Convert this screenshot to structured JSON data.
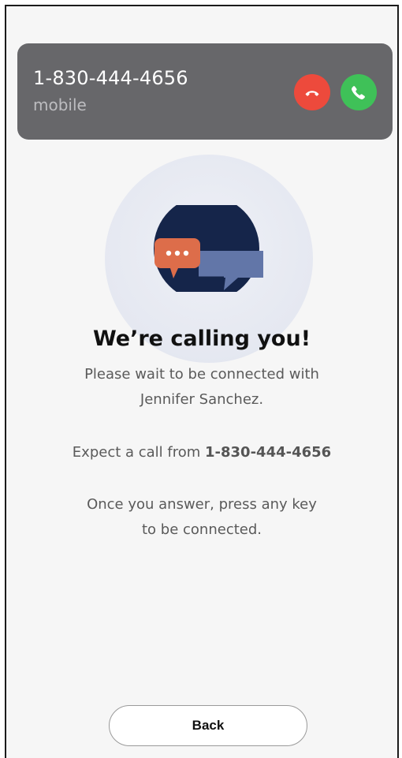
{
  "notification": {
    "caller_number": "1-830-444-4656",
    "caller_type": "mobile",
    "decline_icon": "phone-hangup-icon",
    "accept_icon": "phone-icon",
    "decline_color": "#ed4a3c",
    "accept_color": "#3fc158",
    "banner_color": "#67676a"
  },
  "illustration": {
    "icon": "chat-bubbles-icon",
    "colors": {
      "circle": "#15254a",
      "bubble_front": "#dd6d4a",
      "bubble_back": "#6276a8"
    }
  },
  "content": {
    "headline": "We’re calling you!",
    "wait_line1": "Please wait to be connected with",
    "wait_line2": "Jennifer Sanchez.",
    "expect_prefix": "Expect a call from ",
    "expect_number": "1-830-444-4656",
    "answer_line1": "Once you answer, press any key",
    "answer_line2": "to be connected."
  },
  "actions": {
    "back_label": "Back"
  }
}
